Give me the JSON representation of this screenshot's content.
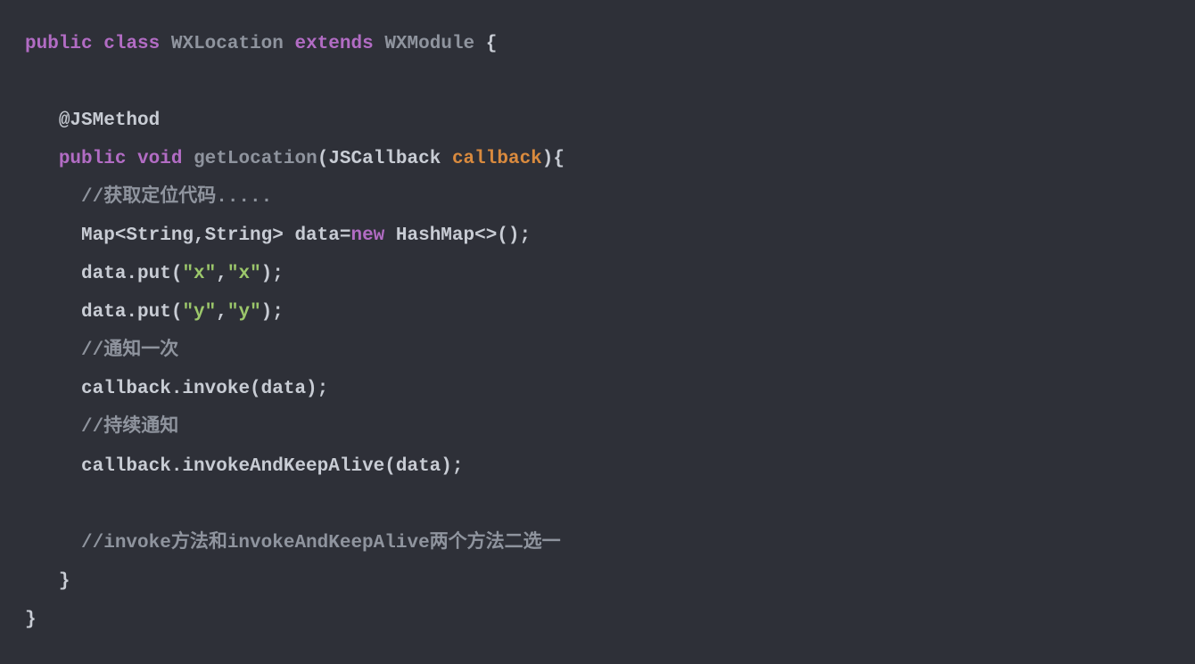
{
  "code": {
    "kw_public": "public",
    "kw_class": "class",
    "kw_extends": "extends",
    "kw_void": "void",
    "kw_new": "new",
    "class_name": "WXLocation",
    "super_class": "WXModule",
    "annotation": "@JSMethod",
    "method_name": "getLocation",
    "param_type": "JSCallback",
    "param_name": "callback",
    "comment1": "//获取定位代码.....",
    "line_map": "Map<String,String> data=",
    "line_map_tail": " HashMap<>();",
    "put1_a": "data.put(",
    "str_x": "\"x\"",
    "comma": ",",
    "put1_b": ");",
    "put2_a": "data.put(",
    "str_y": "\"y\"",
    "put2_b": ");",
    "comment2": "//通知一次",
    "invoke1": "callback.invoke(data);",
    "comment3": "//持续通知",
    "invoke2": "callback.invokeAndKeepAlive(data);",
    "comment4": "//invoke方法和invokeAndKeepAlive两个方法二选一",
    "brace_open": "{",
    "brace_close": "}",
    "paren_open": "(",
    "paren_close": ")"
  }
}
